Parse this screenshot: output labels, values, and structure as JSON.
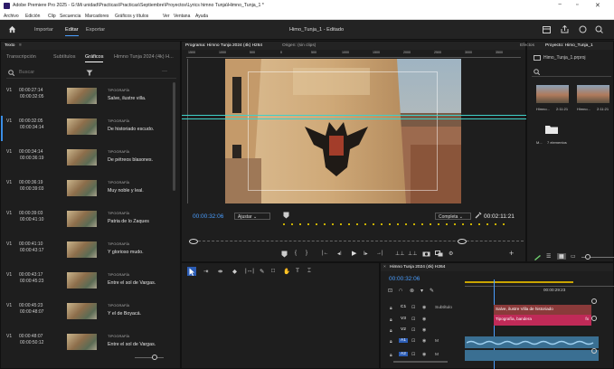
{
  "window": {
    "title": "Adobe Premiere Pro 2025 - G:\\Mi unidad\\Practicas\\Practicas\\Septiembre\\Proyectos\\Lyrics himno Tunja\\Himno_Tunja_1 *",
    "min": "−",
    "max": "▫",
    "close": "✕"
  },
  "menu": [
    "Archivo",
    "Edición",
    "Clip",
    "Secuencia",
    "Marcadores",
    "Gráficos y títulos",
    "Ver",
    "Ventana",
    "Ayuda"
  ],
  "header": {
    "workspaces": [
      "Importar",
      "Editar",
      "Exportar"
    ],
    "active": "Editar",
    "center_title": "Himo_Tunja_1 - Editado"
  },
  "left_panel": {
    "tab": "Texto",
    "subtabs": [
      "Transcripción",
      "Subtítulos",
      "Gráficos",
      "Himno Tunja 2024 (4k) H..."
    ],
    "active_subtab": "Gráficos",
    "search_placeholder": "Buscar",
    "more": "···",
    "items": [
      {
        "track": "V1",
        "in": "00:00:27:14",
        "out": "00:00:32:05",
        "kind": "TIPOGRAFÍA",
        "text": "Salve, ilustre villa."
      },
      {
        "track": "V1",
        "in": "00:00:32:05",
        "out": "00:00:34:14",
        "kind": "TIPOGRAFÍA",
        "text": "De historiado escudo."
      },
      {
        "track": "V1",
        "in": "00:00:34:14",
        "out": "00:00:36:19",
        "kind": "TIPOGRAFÍA",
        "text": "De pétreos blasones."
      },
      {
        "track": "V1",
        "in": "00:00:36:19",
        "out": "00:00:39:03",
        "kind": "TIPOGRAFÍA",
        "text": "Muy noble y leal."
      },
      {
        "track": "V1",
        "in": "00:00:39:03",
        "out": "00:00:41:10",
        "kind": "TIPOGRAFÍA",
        "text": "Patria de lo Zaques"
      },
      {
        "track": "V1",
        "in": "00:00:41:10",
        "out": "00:00:43:17",
        "kind": "TIPOGRAFÍA",
        "text": "Y glorioso mudo."
      },
      {
        "track": "V1",
        "in": "00:00:43:17",
        "out": "00:00:45:23",
        "kind": "TIPOGRAFÍA",
        "text": "Entre el sol de Vargas."
      },
      {
        "track": "V1",
        "in": "00:00:45:23",
        "out": "00:00:48:07",
        "kind": "TIPOGRAFÍA",
        "text": "Y el de Boyacá."
      },
      {
        "track": "V1",
        "in": "00:00:48:07",
        "out": "00:00:50:12",
        "kind": "TIPOGRAFÍA",
        "text": "Entre el sol de Vargas."
      }
    ]
  },
  "program": {
    "tab": "Programa: Himno Tunja 2024 (4k) H264",
    "tab2": "Origen: (sin clips)",
    "ruler": [
      "1500",
      "1000",
      "500",
      "0",
      "500",
      "1000",
      "1500",
      "2000",
      "2500",
      "3000",
      "3500",
      "4000"
    ],
    "timecode": "00:00:32:06",
    "fit": "Ajustar",
    "quality": "Completa",
    "duration": "00:02:11:21"
  },
  "project": {
    "tab1": "Efectos",
    "tab2": "Proyecto: Himo_Tunja_1",
    "file": "Himo_Tunja_1.prproj",
    "clips": [
      {
        "name": "Himno...",
        "dur": "2:11:21"
      },
      {
        "name": "Himno...",
        "dur": "2:11:21"
      }
    ],
    "folder": {
      "name": "M...",
      "count": "7 elementos"
    }
  },
  "timeline": {
    "tab": "Himno Tunja 2024 (4k) H264",
    "timecode": "00:00:32:06",
    "ruler_time": "00:00:29:23",
    "tracks": [
      {
        "id": "C1",
        "label": "Subtítulo"
      },
      {
        "id": "V3",
        "label": ""
      },
      {
        "id": "V2",
        "label": ""
      },
      {
        "id": "A1",
        "label": "M"
      },
      {
        "id": "A2",
        "label": "M"
      }
    ],
    "clips": {
      "caption": "Salve, ilustre Villa de historiado",
      "graphic": "Tipografía, bandera",
      "fx": "fx"
    }
  },
  "colors": {
    "accent": "#4a9eff",
    "caption_clip": "#8a3a3a",
    "graphic_clip": "#c02a58",
    "audio_clip": "#3a6f92",
    "playhead": "#4a9eff"
  }
}
